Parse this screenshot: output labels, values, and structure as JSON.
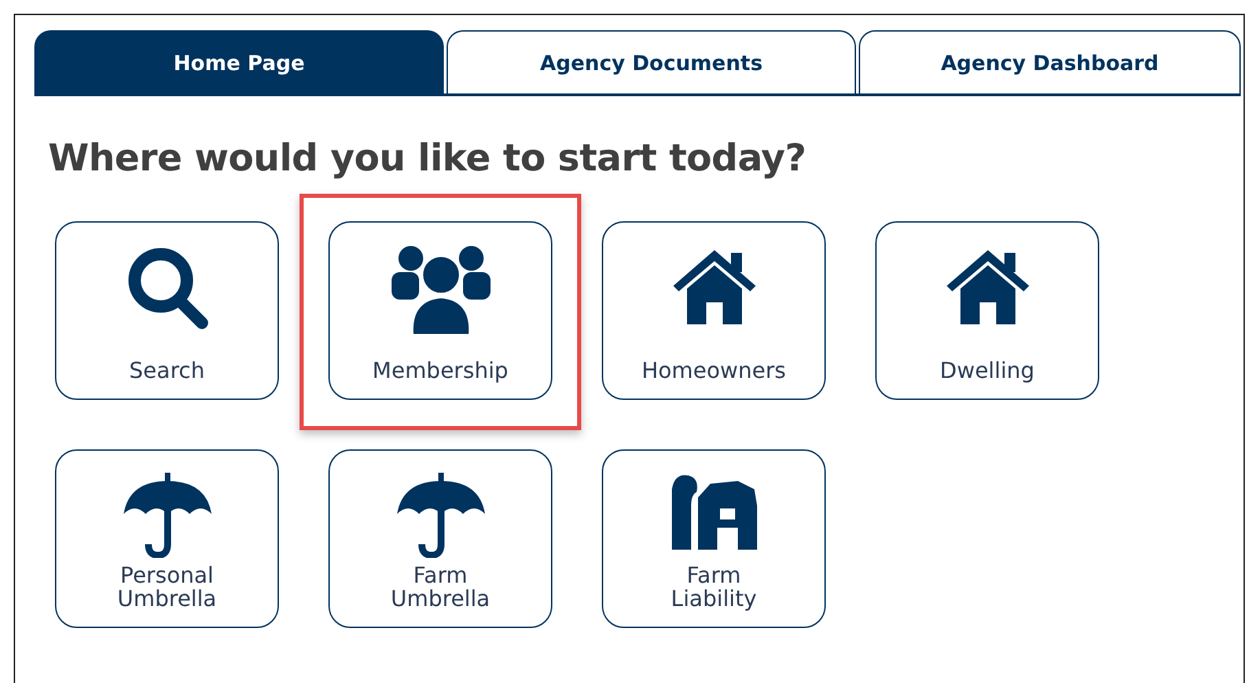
{
  "tabs": [
    {
      "label": "Home Page",
      "selected": true
    },
    {
      "label": "Agency Documents",
      "selected": false
    },
    {
      "label": "Agency Dashboard",
      "selected": false
    }
  ],
  "heading": "Where would you like to start today?",
  "tiles": [
    {
      "label": "Search",
      "kind": "search",
      "highlighted": false
    },
    {
      "label": "Membership",
      "kind": "people",
      "highlighted": true
    },
    {
      "label": "Homeowners",
      "kind": "house",
      "highlighted": false
    },
    {
      "label": "Dwelling",
      "kind": "house",
      "highlighted": false
    },
    {
      "label": "Personal Umbrella",
      "kind": "umbrella",
      "highlighted": false
    },
    {
      "label": "Farm Umbrella",
      "kind": "umbrella",
      "highlighted": false
    },
    {
      "label": "Farm Liability",
      "kind": "barn",
      "highlighted": false
    }
  ]
}
